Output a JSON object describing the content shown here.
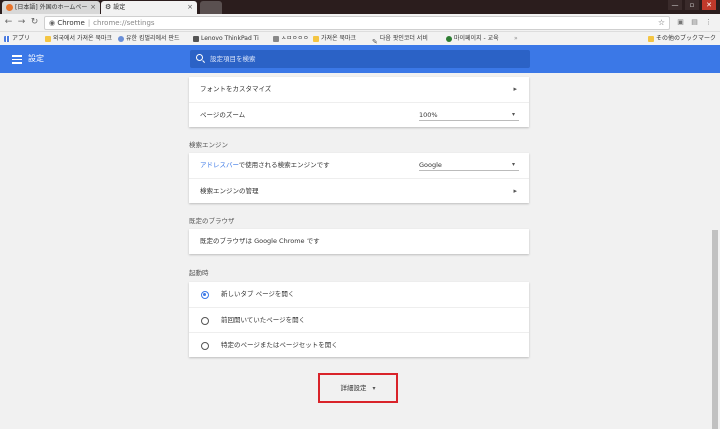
{
  "tabs": [
    {
      "title": "[日本語] 外国のホームペー",
      "close": "×"
    },
    {
      "title": "設定",
      "close": "×"
    }
  ],
  "window_controls": {
    "minimize": "—",
    "maximize": "▫",
    "close": "✕"
  },
  "address_bar": {
    "secure_label": "Chrome",
    "url": "chrome://settings",
    "separator": "|"
  },
  "bookmarks": {
    "apps_label": "アプリ",
    "items": [
      "외국에서 가져온 북마크",
      "유한 킴벌리에서 판드",
      "Lenovo ThinkPad Ti",
      "ㅅㅁㅇㅇㅇ",
      "가져온 북마크",
      "다음 팟인코더 서비",
      "마이페이지 - 교육"
    ],
    "other_label": "その他のブックマーク"
  },
  "header": {
    "title": "設定",
    "search_placeholder": "設定項目を検索"
  },
  "appearance_card": {
    "fonts_label": "フォントをカスタマイズ",
    "zoom_label": "ページのズーム",
    "zoom_value": "100%"
  },
  "search_engine": {
    "section_title": "検索エンジン",
    "address_bar_link": "アドレスバー",
    "address_bar_rest": "で使用される検索エンジンです",
    "engine_value": "Google",
    "manage_label": "検索エンジンの管理"
  },
  "default_browser": {
    "section_title": "既定のブラウザ",
    "status": "既定のブラウザは Google Chrome です"
  },
  "startup": {
    "section_title": "起動時",
    "options": [
      "新しいタブ ページを開く",
      "前回開いていたページを開く",
      "特定のページまたはページセットを開く"
    ],
    "selected_index": 0
  },
  "advanced_button": {
    "label": "詳細設定",
    "arrow": "▾"
  },
  "colors": {
    "header_blue": "#3b78e7",
    "highlight_red": "#d9232a"
  }
}
